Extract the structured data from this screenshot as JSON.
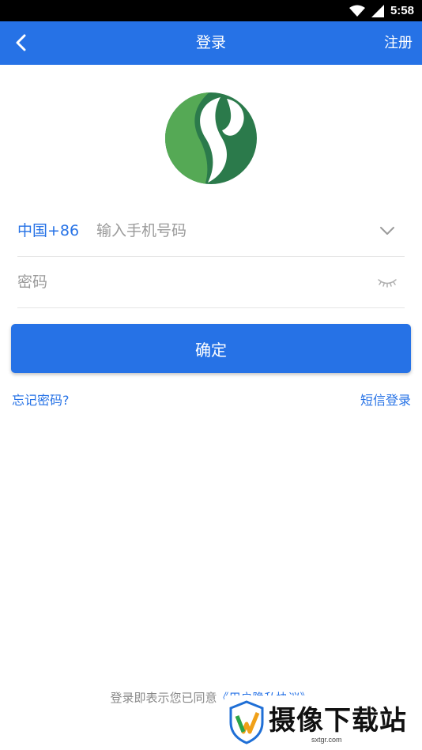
{
  "status_bar": {
    "time": "5:58",
    "icons": [
      "wifi-icon",
      "cellular-signal-icon"
    ]
  },
  "nav": {
    "title": "登录",
    "register_label": "注册"
  },
  "login_form": {
    "country_code": "中国+86",
    "phone_placeholder": "输入手机号码",
    "password_placeholder": "密码",
    "confirm_label": "确定"
  },
  "links": {
    "forgot_password": "忘记密码?",
    "sms_login": "短信登录"
  },
  "footer": {
    "agreement_prefix": "登录即表示您已同意",
    "agreement_link": "《用户隐私协议》"
  },
  "watermark": {
    "text": "摄像下载站",
    "url": "sxtgr.com"
  },
  "colors": {
    "primary": "#2672e6",
    "logo_light_green": "#55a955",
    "logo_dark_green": "#2b7a4b"
  }
}
